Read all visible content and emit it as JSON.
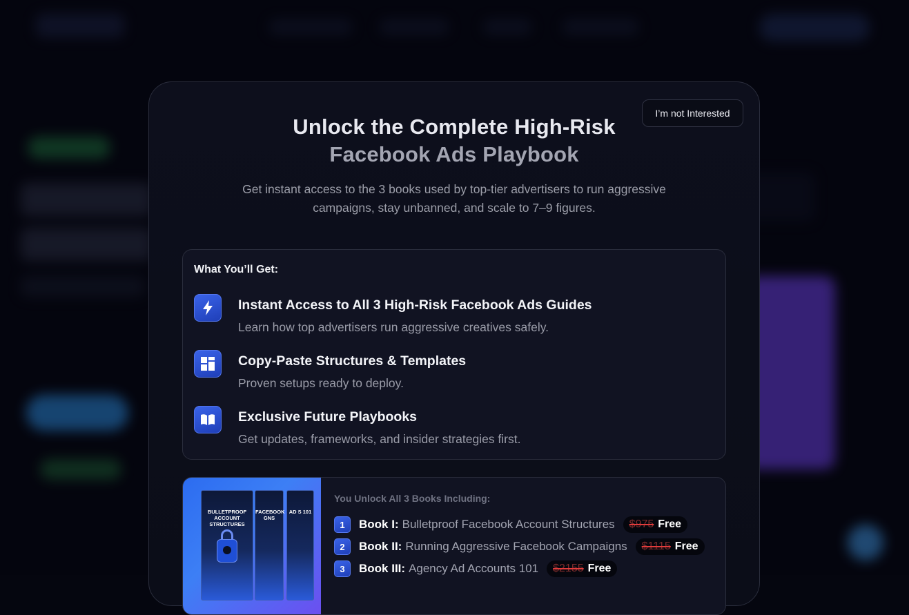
{
  "modal": {
    "dismiss_label": "I’m not Interested",
    "title_line1": "Unlock the Complete High-Risk",
    "title_line2": "Facebook Ads Playbook",
    "subtitle": "Get instant access to the 3 books used by top-tier advertisers to run aggressive campaigns, stay unbanned, and scale to 7–9 figures."
  },
  "benefits": {
    "heading": "What You’ll Get:",
    "items": [
      {
        "icon": "lightning-icon",
        "title": "Instant Access to All 3 High-Risk Facebook Ads Guides",
        "description": "Learn how top advertisers run aggressive creatives safely."
      },
      {
        "icon": "layout-grid-icon",
        "title": "Copy-Paste Structures & Templates",
        "description": "Proven setups ready to deploy."
      },
      {
        "icon": "open-book-icon",
        "title": "Exclusive Future Playbooks",
        "description": "Get updates, frameworks, and insider strategies first."
      }
    ]
  },
  "books": {
    "heading": "You Unlock All 3 Books Including:",
    "cover_texts": [
      "BULLETPROOF ACCOUNT STRUCTURES",
      "FACEBOOK GNS",
      "AD S 101"
    ],
    "items": [
      {
        "number": "1",
        "label": "Book I:",
        "name": "Bulletproof Facebook Account Structures",
        "old_price": "$975",
        "new_price": "Free"
      },
      {
        "number": "2",
        "label": "Book II:",
        "name": "Running Aggressive Facebook Campaigns",
        "old_price": "$1115",
        "new_price": "Free"
      },
      {
        "number": "3",
        "label": "Book III:",
        "name": "Agency Ad Accounts 101",
        "old_price": "$2155",
        "new_price": "Free"
      }
    ]
  },
  "colors": {
    "accent": "#2f56dc",
    "background": "#05060f",
    "strike": "#e23b3b"
  }
}
